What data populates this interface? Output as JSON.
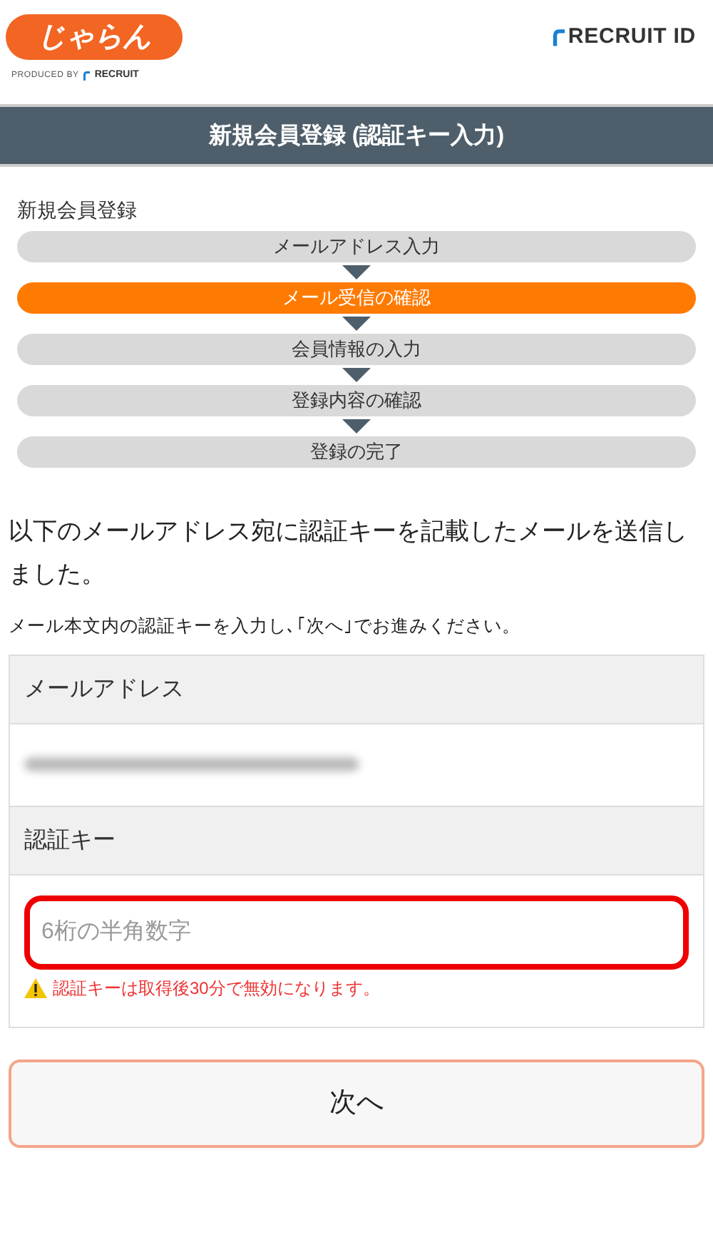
{
  "header": {
    "logo": "じゃらん",
    "produced_by": "PRODUCED BY",
    "produced_brand": "RECRUIT",
    "recruit_id": "RECRUIT ID"
  },
  "title": "新規会員登録 (認証キー入力)",
  "steps_title": "新規会員登録",
  "steps": [
    {
      "label": "メールアドレス入力",
      "selected": false
    },
    {
      "label": "メール受信の確認",
      "selected": true
    },
    {
      "label": "会員情報の入力",
      "selected": false
    },
    {
      "label": "登録内容の確認",
      "selected": false
    },
    {
      "label": "登録の完了",
      "selected": false
    }
  ],
  "message": "以下のメールアドレス宛に認証キーを記載したメールを送信しました。",
  "instruction": "メール本文内の認証キーを入力し､｢次へ｣でお進みください。",
  "email_label": "メールアドレス",
  "key_label": "認証キー",
  "key_field": {
    "placeholder": "6桁の半角数字",
    "error": true
  },
  "warning": "認証キーは取得後30分で無効になります。",
  "next_button": "次へ"
}
